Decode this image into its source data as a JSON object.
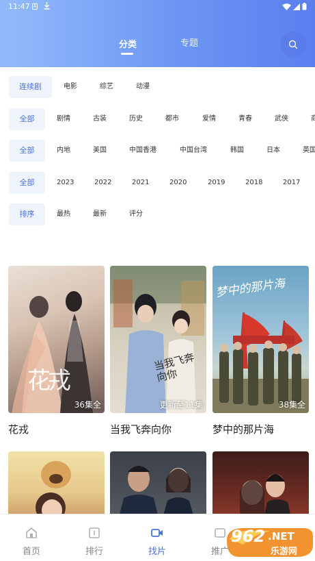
{
  "status_bar": {
    "time": "11:47",
    "notify_a": "A"
  },
  "header": {
    "tabs": [
      {
        "label": "分类",
        "active": true
      },
      {
        "label": "专题",
        "active": false
      }
    ],
    "search_icon": "search-icon"
  },
  "filters": {
    "type": {
      "selected": "连续剧",
      "options": [
        "电影",
        "综艺",
        "动漫"
      ]
    },
    "genre": {
      "selected": "全部",
      "options": [
        "剧情",
        "古装",
        "历史",
        "都市",
        "爱情",
        "青春",
        "武侠",
        "商"
      ]
    },
    "region": {
      "selected": "全部",
      "options": [
        "内地",
        "美国",
        "中国香港",
        "中国台湾",
        "韩国",
        "日本",
        "英国"
      ]
    },
    "year": {
      "selected": "全部",
      "options": [
        "2023",
        "2022",
        "2021",
        "2020",
        "2019",
        "2018",
        "2017"
      ]
    },
    "sort": {
      "selected": "排序",
      "options": [
        "最热",
        "最新",
        "评分"
      ]
    }
  },
  "videos": [
    {
      "title": "花戎",
      "badge": "36集全",
      "poster_text": "花戎"
    },
    {
      "title": "当我飞奔向你",
      "badge": "更新至11集",
      "poster_text": "当我飞奔向你"
    },
    {
      "title": "梦中的那片海",
      "badge": "38集全",
      "poster_text": "梦中的那片海"
    },
    {
      "title": "",
      "badge": ""
    },
    {
      "title": "",
      "badge": ""
    },
    {
      "title": "",
      "badge": ""
    }
  ],
  "bottom_nav": [
    {
      "label": "首页",
      "icon": "home-icon",
      "active": false
    },
    {
      "label": "排行",
      "icon": "ranking-icon",
      "active": false
    },
    {
      "label": "找片",
      "icon": "video-icon",
      "active": true
    },
    {
      "label": "推广",
      "icon": "promote-icon",
      "active": false
    }
  ],
  "watermark": {
    "brand": "962",
    "suffix": ".NET",
    "site": "乐游网"
  },
  "colors": {
    "accent": "#4a74d8",
    "header_start": "#93bbfb",
    "header_end": "#5a7fef"
  }
}
